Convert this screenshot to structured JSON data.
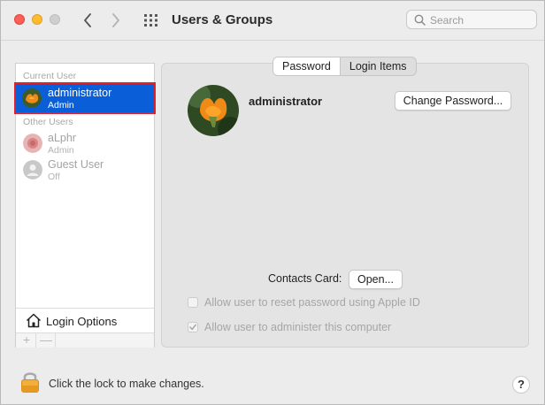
{
  "window": {
    "title": "Users & Groups",
    "search_placeholder": "Search"
  },
  "sidebar": {
    "current_user_label": "Current User",
    "other_users_label": "Other Users",
    "users": [
      {
        "name": "administrator",
        "role": "Admin",
        "selected": true
      },
      {
        "name": "aLphr",
        "role": "Admin",
        "selected": false
      },
      {
        "name": "Guest User",
        "role": "Off",
        "selected": false
      }
    ],
    "login_options_label": "Login Options",
    "add_label": "+",
    "remove_label": "—"
  },
  "tabs": [
    {
      "label": "Password",
      "active": true
    },
    {
      "label": "Login Items",
      "active": false
    }
  ],
  "detail": {
    "user_name": "administrator",
    "change_password_label": "Change Password...",
    "contacts_card_label": "Contacts Card:",
    "open_label": "Open...",
    "reset_password_label": "Allow user to reset password using Apple ID",
    "administer_label": "Allow user to administer this computer",
    "administer_checked": true
  },
  "footer": {
    "lock_text": "Click the lock to make changes.",
    "help_label": "?"
  },
  "colors": {
    "selection": "#0a5fd8",
    "highlight_border": "#e0202a",
    "close": "#fe5f57",
    "minimize": "#febc2e"
  }
}
